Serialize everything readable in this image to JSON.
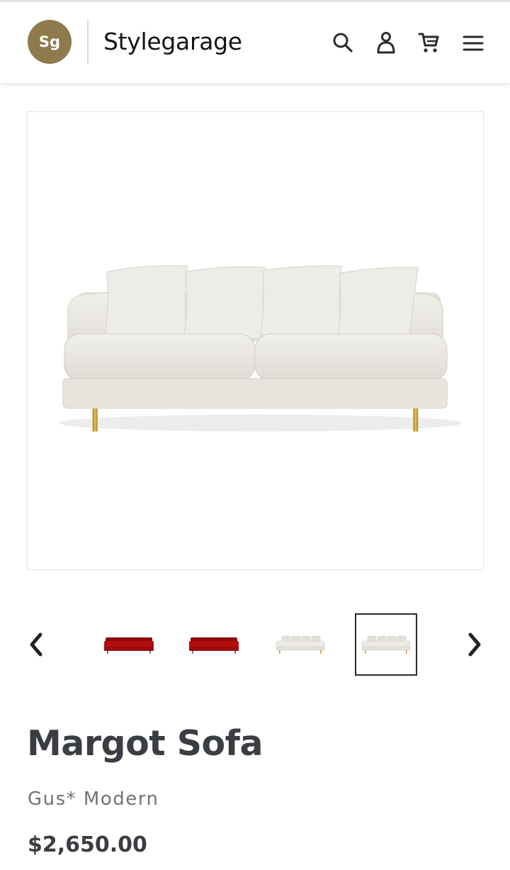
{
  "header": {
    "logo_initials": "Sg",
    "brand_name": "Stylegarage",
    "icons": [
      "search-icon",
      "account-icon",
      "cart-icon",
      "menu-icon"
    ]
  },
  "gallery": {
    "main_image": "sofa-cream-front",
    "thumbnails": [
      {
        "image": "sofa-red",
        "selected": false
      },
      {
        "image": "sofa-red",
        "selected": false
      },
      {
        "image": "sofa-cream",
        "selected": false
      },
      {
        "image": "sofa-cream",
        "selected": true
      }
    ],
    "prev_icon": "chevron-left-icon",
    "next_icon": "chevron-right-icon"
  },
  "product": {
    "title": "Margot Sofa",
    "vendor": "Gus* Modern",
    "price": "$2,650.00"
  },
  "colors": {
    "logo_badge": "#8e7a4b",
    "text_primary": "#3a3d42",
    "text_secondary": "#707378",
    "sofa_red": "#a80b0b",
    "sofa_cream": "#eceae5",
    "leg_brass": "#c9a233"
  }
}
